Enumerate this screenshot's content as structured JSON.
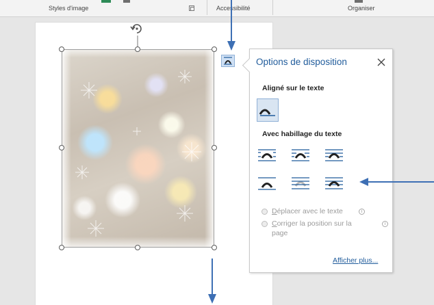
{
  "ribbon": {
    "groups": [
      "Styles d'image",
      "Accessibilité",
      "Organiser"
    ]
  },
  "panel": {
    "title": "Options de disposition",
    "inline_heading": "Aligné sur le texte",
    "wrapping_heading": "Avec habillage du texte",
    "inline_options": [
      {
        "icon": "wrap-inline-with-text-icon",
        "selected": true
      }
    ],
    "wrapping_options": [
      {
        "icon": "wrap-square-icon"
      },
      {
        "icon": "wrap-tight-icon"
      },
      {
        "icon": "wrap-through-icon"
      },
      {
        "icon": "wrap-top-and-bottom-icon"
      },
      {
        "icon": "wrap-behind-text-icon"
      },
      {
        "icon": "wrap-in-front-of-text-icon"
      }
    ],
    "move_with_text": {
      "accel": "D",
      "rest": "éplacer avec le texte",
      "checked": false
    },
    "fix_position": {
      "accel": "C",
      "rest": "orriger la position sur la",
      "line2": "page",
      "checked": false
    },
    "more_link": "Afficher plus..."
  },
  "colors": {
    "accent": "#1f5b9b",
    "arrow": "#3d6fb4",
    "selected_bg": "#d9e5f2"
  }
}
